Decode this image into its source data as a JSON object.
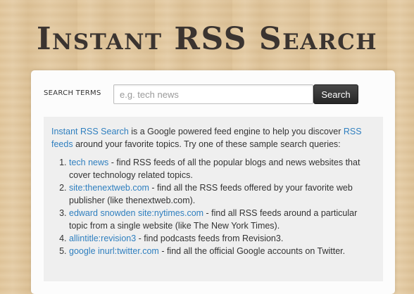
{
  "header": {
    "title": "Instant RSS Search"
  },
  "search": {
    "label": "SEARCH TERMS",
    "placeholder": "e.g. tech news",
    "value": "",
    "button_label": "Search"
  },
  "intro": {
    "link1": "Instant RSS Search",
    "text1": " is a Google powered feed engine to help you discover ",
    "link2": "RSS feeds",
    "text2": " around your favorite topics. Try one of these sample search queries:"
  },
  "examples": [
    {
      "query": "tech news",
      "description": " - find RSS feeds of all the popular blogs and news websites that cover technology related topics."
    },
    {
      "query": "site:thenextweb.com",
      "description": " - find all the RSS feeds offered by your favorite web publisher (like thenextweb.com)."
    },
    {
      "query": "edward snowden site:nytimes.com",
      "description": " - find all RSS feeds around a particular topic from a single website (like The New York Times)."
    },
    {
      "query": "allintitle:revision3",
      "description": " - find podcasts feeds from Revision3."
    },
    {
      "query": "google inurl:twitter.com",
      "description": " - find all the official Google accounts on Twitter."
    }
  ],
  "colors": {
    "link": "#2f7fbf",
    "button": "#333333",
    "panel": "#fcfcfc",
    "info_box": "#efefef",
    "background": "#e2c79c"
  }
}
